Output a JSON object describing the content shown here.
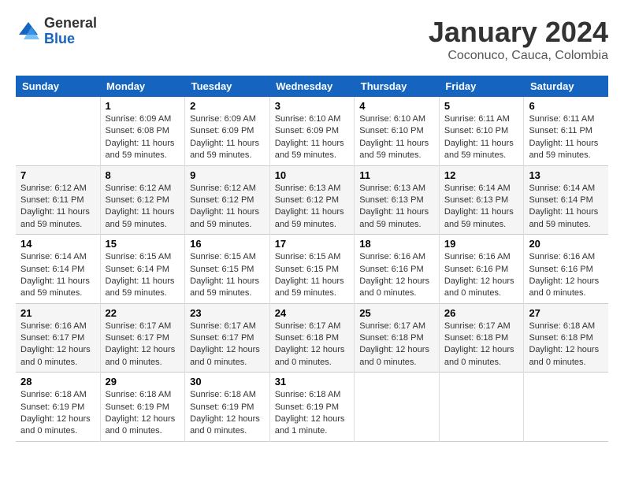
{
  "logo": {
    "general": "General",
    "blue": "Blue"
  },
  "title": "January 2024",
  "subtitle": "Coconuco, Cauca, Colombia",
  "days_header": [
    "Sunday",
    "Monday",
    "Tuesday",
    "Wednesday",
    "Thursday",
    "Friday",
    "Saturday"
  ],
  "weeks": [
    [
      {
        "num": "",
        "info": ""
      },
      {
        "num": "1",
        "info": "Sunrise: 6:09 AM\nSunset: 6:08 PM\nDaylight: 11 hours\nand 59 minutes."
      },
      {
        "num": "2",
        "info": "Sunrise: 6:09 AM\nSunset: 6:09 PM\nDaylight: 11 hours\nand 59 minutes."
      },
      {
        "num": "3",
        "info": "Sunrise: 6:10 AM\nSunset: 6:09 PM\nDaylight: 11 hours\nand 59 minutes."
      },
      {
        "num": "4",
        "info": "Sunrise: 6:10 AM\nSunset: 6:10 PM\nDaylight: 11 hours\nand 59 minutes."
      },
      {
        "num": "5",
        "info": "Sunrise: 6:11 AM\nSunset: 6:10 PM\nDaylight: 11 hours\nand 59 minutes."
      },
      {
        "num": "6",
        "info": "Sunrise: 6:11 AM\nSunset: 6:11 PM\nDaylight: 11 hours\nand 59 minutes."
      }
    ],
    [
      {
        "num": "7",
        "info": "Sunrise: 6:12 AM\nSunset: 6:11 PM\nDaylight: 11 hours\nand 59 minutes."
      },
      {
        "num": "8",
        "info": "Sunrise: 6:12 AM\nSunset: 6:12 PM\nDaylight: 11 hours\nand 59 minutes."
      },
      {
        "num": "9",
        "info": "Sunrise: 6:12 AM\nSunset: 6:12 PM\nDaylight: 11 hours\nand 59 minutes."
      },
      {
        "num": "10",
        "info": "Sunrise: 6:13 AM\nSunset: 6:12 PM\nDaylight: 11 hours\nand 59 minutes."
      },
      {
        "num": "11",
        "info": "Sunrise: 6:13 AM\nSunset: 6:13 PM\nDaylight: 11 hours\nand 59 minutes."
      },
      {
        "num": "12",
        "info": "Sunrise: 6:14 AM\nSunset: 6:13 PM\nDaylight: 11 hours\nand 59 minutes."
      },
      {
        "num": "13",
        "info": "Sunrise: 6:14 AM\nSunset: 6:14 PM\nDaylight: 11 hours\nand 59 minutes."
      }
    ],
    [
      {
        "num": "14",
        "info": "Sunrise: 6:14 AM\nSunset: 6:14 PM\nDaylight: 11 hours\nand 59 minutes."
      },
      {
        "num": "15",
        "info": "Sunrise: 6:15 AM\nSunset: 6:14 PM\nDaylight: 11 hours\nand 59 minutes."
      },
      {
        "num": "16",
        "info": "Sunrise: 6:15 AM\nSunset: 6:15 PM\nDaylight: 11 hours\nand 59 minutes."
      },
      {
        "num": "17",
        "info": "Sunrise: 6:15 AM\nSunset: 6:15 PM\nDaylight: 11 hours\nand 59 minutes."
      },
      {
        "num": "18",
        "info": "Sunrise: 6:16 AM\nSunset: 6:16 PM\nDaylight: 12 hours\nand 0 minutes."
      },
      {
        "num": "19",
        "info": "Sunrise: 6:16 AM\nSunset: 6:16 PM\nDaylight: 12 hours\nand 0 minutes."
      },
      {
        "num": "20",
        "info": "Sunrise: 6:16 AM\nSunset: 6:16 PM\nDaylight: 12 hours\nand 0 minutes."
      }
    ],
    [
      {
        "num": "21",
        "info": "Sunrise: 6:16 AM\nSunset: 6:17 PM\nDaylight: 12 hours\nand 0 minutes."
      },
      {
        "num": "22",
        "info": "Sunrise: 6:17 AM\nSunset: 6:17 PM\nDaylight: 12 hours\nand 0 minutes."
      },
      {
        "num": "23",
        "info": "Sunrise: 6:17 AM\nSunset: 6:17 PM\nDaylight: 12 hours\nand 0 minutes."
      },
      {
        "num": "24",
        "info": "Sunrise: 6:17 AM\nSunset: 6:18 PM\nDaylight: 12 hours\nand 0 minutes."
      },
      {
        "num": "25",
        "info": "Sunrise: 6:17 AM\nSunset: 6:18 PM\nDaylight: 12 hours\nand 0 minutes."
      },
      {
        "num": "26",
        "info": "Sunrise: 6:17 AM\nSunset: 6:18 PM\nDaylight: 12 hours\nand 0 minutes."
      },
      {
        "num": "27",
        "info": "Sunrise: 6:18 AM\nSunset: 6:18 PM\nDaylight: 12 hours\nand 0 minutes."
      }
    ],
    [
      {
        "num": "28",
        "info": "Sunrise: 6:18 AM\nSunset: 6:19 PM\nDaylight: 12 hours\nand 0 minutes."
      },
      {
        "num": "29",
        "info": "Sunrise: 6:18 AM\nSunset: 6:19 PM\nDaylight: 12 hours\nand 0 minutes."
      },
      {
        "num": "30",
        "info": "Sunrise: 6:18 AM\nSunset: 6:19 PM\nDaylight: 12 hours\nand 0 minutes."
      },
      {
        "num": "31",
        "info": "Sunrise: 6:18 AM\nSunset: 6:19 PM\nDaylight: 12 hours\nand 1 minute."
      },
      {
        "num": "",
        "info": ""
      },
      {
        "num": "",
        "info": ""
      },
      {
        "num": "",
        "info": ""
      }
    ]
  ]
}
